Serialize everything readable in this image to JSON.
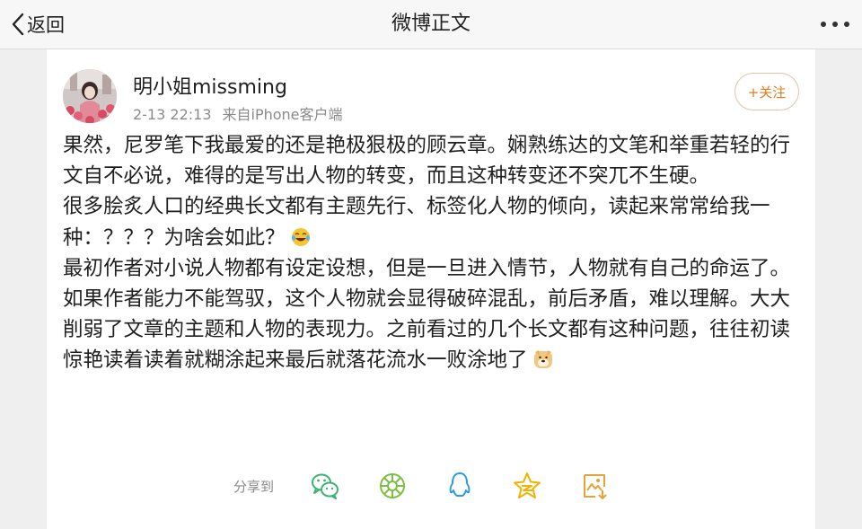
{
  "nav": {
    "back_label": "返回",
    "title": "微博正文"
  },
  "post": {
    "user_name": "明小姐missming",
    "time": "2-13 22:13",
    "source": "来自iPhone客户端",
    "follow_label": "+关注",
    "paragraphs": [
      "果然，尼罗笔下我最爱的还是艳极狠极的顾云章。娴熟练达的文笔和举重若轻的行文自不必说，难得的是写出人物的转变，而且这种转变还不突兀不生硬。",
      "很多脍炙人口的经典长文都有主题先行、标签化人物的倾向，读起来常常给我一种：？？？为啥会如此？",
      "最初作者对小说人物都有设定设想，但是一旦进入情节，人物就有自己的命运了。如果作者能力不能驾驭，这个人物就会显得破碎混乱，前后矛盾，难以理解。大大削弱了文章的主题和人物的表现力。之前看过的几个长文都有这种问题，往往初读惊艳读着读着就糊涂起来最后就落花流水一败涂地了"
    ]
  },
  "share": {
    "label": "分享到",
    "icons": [
      "wechat-icon",
      "moments-icon",
      "qq-icon",
      "qzone-star-icon",
      "save-image-icon"
    ]
  },
  "colors": {
    "accent_orange": "#e07b1e",
    "share_green": "#3cb371",
    "qq_blue": "#2a9de0",
    "star_yellow": "#f0b400"
  }
}
